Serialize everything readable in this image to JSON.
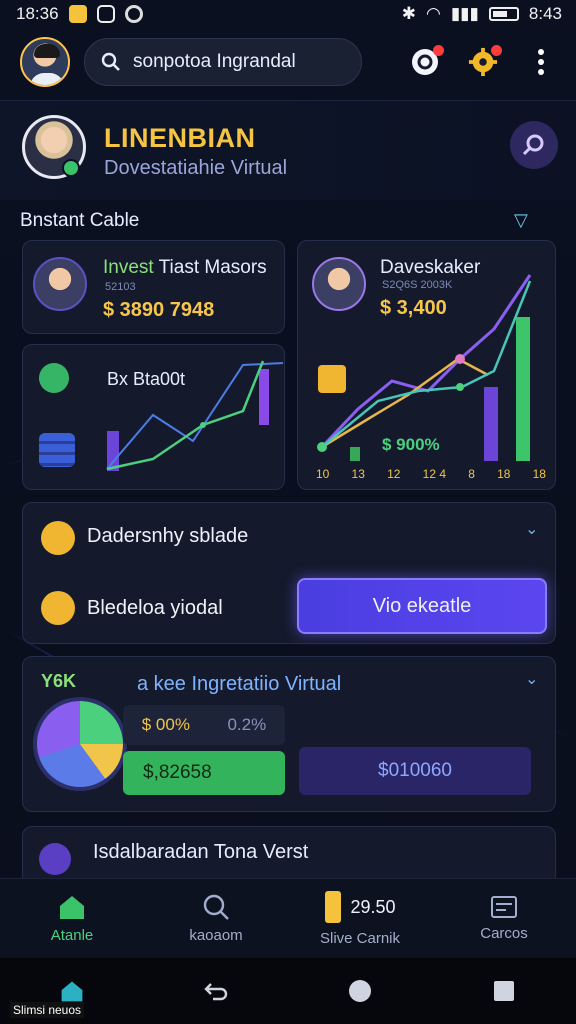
{
  "status_bar": {
    "time_left": "18:36",
    "time_right": "8:43"
  },
  "search": {
    "query": "sonpotoa Ingrandal"
  },
  "header": {
    "title": "LINENBIAN",
    "subtitle": "Dovestatiahie Virtual"
  },
  "section": {
    "label": "Bnstant Cable"
  },
  "cards": {
    "invest_1": {
      "title_green": "Invest",
      "title_rest": " Tiast Masors",
      "sub": "52103",
      "value": "$ 3890 7948"
    },
    "invest_2": {
      "title": "Daveskaker",
      "sub": "S2Q6S 2003K",
      "value": "$ 3,400"
    },
    "chart_small": {
      "label": "Bx Bta00t"
    },
    "chart_big": {
      "value": "$ 900%",
      "x_labels": [
        "10",
        "13",
        "12",
        "12 4",
        "8",
        "18",
        "18"
      ]
    }
  },
  "accordion": {
    "row1": "Dadersnhy sblade",
    "row2": "Bledeloa yiodal",
    "cta": "Vio ekeatle"
  },
  "portfolio": {
    "left_label": "Y6K",
    "title": "a kee Ingretatiio Virtual",
    "pct_1": "$ 00%",
    "pct_2": "0.2%",
    "green_value": "$,82658",
    "purple_value": "$010060"
  },
  "bottom_card": {
    "title": "Isdalbaradan Tona Verst"
  },
  "nav": [
    {
      "label": "Atanle",
      "icon": "home-icon"
    },
    {
      "label": "kaoaom",
      "icon": "search-icon"
    },
    {
      "label": "Slive Carnik",
      "icon": "phone-icon",
      "value": "29.50"
    },
    {
      "label": "Carcos",
      "icon": "cards-icon"
    }
  ],
  "watermark": "Slimsi neuos",
  "colors": {
    "accent": "#5b46f0",
    "gold": "#f5c542",
    "green": "#4bd07e",
    "bg": "#0b1020"
  }
}
